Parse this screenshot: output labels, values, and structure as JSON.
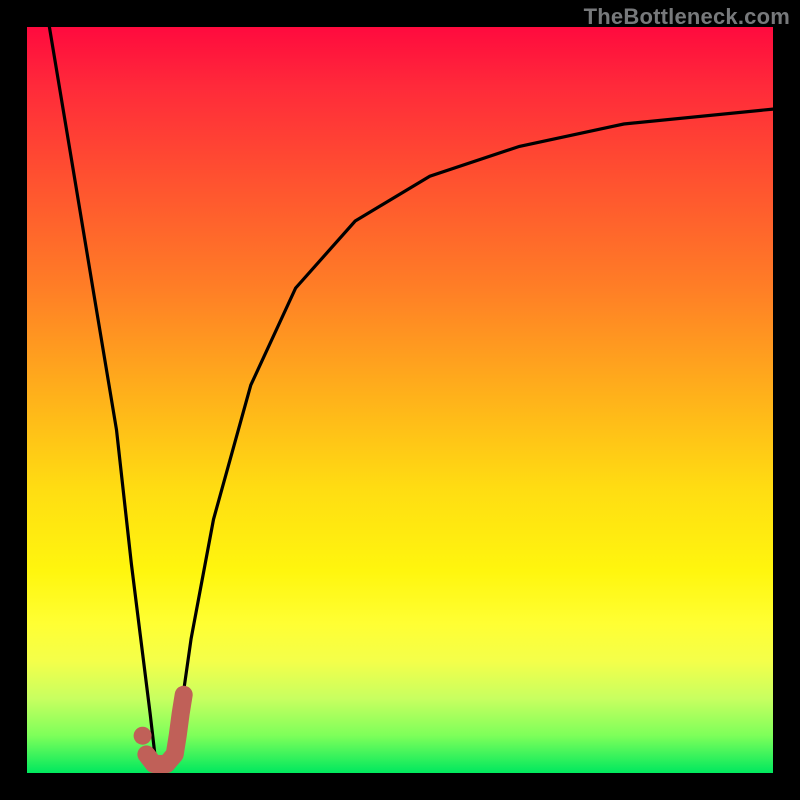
{
  "watermark": "TheBottleneck.com",
  "colors": {
    "frame": "#000000",
    "curve": "#000000",
    "marker": "#c06058",
    "gradient_top": "#ff0a3e",
    "gradient_bottom": "#00e85e"
  },
  "chart_data": {
    "type": "line",
    "title": "",
    "xlabel": "",
    "ylabel": "",
    "xlim": [
      0,
      100
    ],
    "ylim": [
      0,
      100
    ],
    "series": [
      {
        "name": "bottleneck-curve-left",
        "x": [
          3,
          6,
          9,
          12,
          14,
          15.5,
          16.5,
          17.2
        ],
        "values": [
          100,
          82,
          64,
          46,
          28,
          16,
          8,
          2
        ]
      },
      {
        "name": "bottleneck-curve-right",
        "x": [
          20,
          22,
          25,
          30,
          36,
          44,
          54,
          66,
          80,
          100
        ],
        "values": [
          4,
          18,
          34,
          52,
          65,
          74,
          80,
          84,
          87,
          89
        ]
      }
    ],
    "marker": {
      "name": "j-marker",
      "dot": {
        "x": 15.5,
        "y": 5
      },
      "hook": [
        {
          "x": 16,
          "y": 2.5
        },
        {
          "x": 17,
          "y": 1.2
        },
        {
          "x": 18.7,
          "y": 1.2
        },
        {
          "x": 19.8,
          "y": 2.5
        },
        {
          "x": 20.2,
          "y": 5
        },
        {
          "x": 20.6,
          "y": 8
        },
        {
          "x": 21.0,
          "y": 10.5
        }
      ]
    },
    "annotations": []
  }
}
